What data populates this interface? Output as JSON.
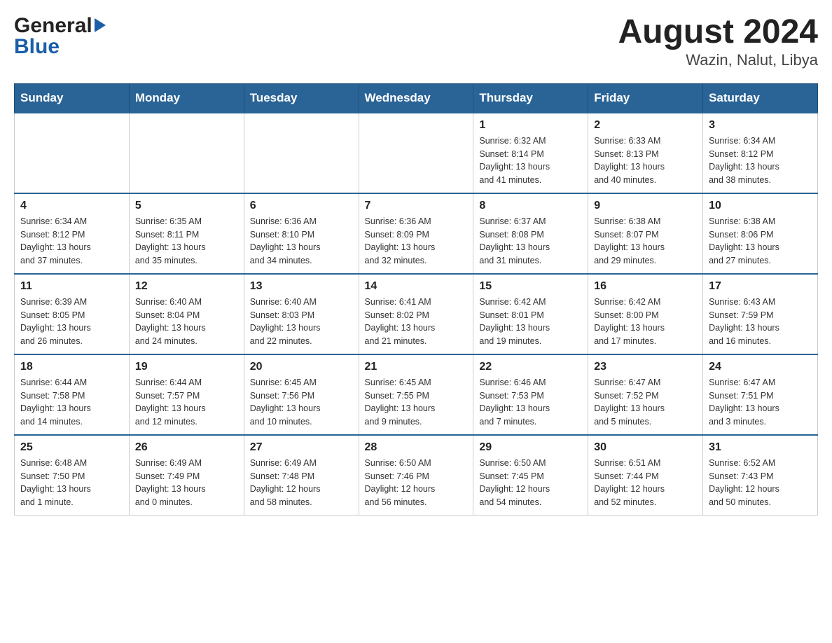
{
  "header": {
    "logo_general": "General",
    "logo_blue": "Blue",
    "month_year": "August 2024",
    "location": "Wazin, Nalut, Libya"
  },
  "calendar": {
    "days_of_week": [
      "Sunday",
      "Monday",
      "Tuesday",
      "Wednesday",
      "Thursday",
      "Friday",
      "Saturday"
    ],
    "weeks": [
      [
        {
          "day": "",
          "info": ""
        },
        {
          "day": "",
          "info": ""
        },
        {
          "day": "",
          "info": ""
        },
        {
          "day": "",
          "info": ""
        },
        {
          "day": "1",
          "info": "Sunrise: 6:32 AM\nSunset: 8:14 PM\nDaylight: 13 hours\nand 41 minutes."
        },
        {
          "day": "2",
          "info": "Sunrise: 6:33 AM\nSunset: 8:13 PM\nDaylight: 13 hours\nand 40 minutes."
        },
        {
          "day": "3",
          "info": "Sunrise: 6:34 AM\nSunset: 8:12 PM\nDaylight: 13 hours\nand 38 minutes."
        }
      ],
      [
        {
          "day": "4",
          "info": "Sunrise: 6:34 AM\nSunset: 8:12 PM\nDaylight: 13 hours\nand 37 minutes."
        },
        {
          "day": "5",
          "info": "Sunrise: 6:35 AM\nSunset: 8:11 PM\nDaylight: 13 hours\nand 35 minutes."
        },
        {
          "day": "6",
          "info": "Sunrise: 6:36 AM\nSunset: 8:10 PM\nDaylight: 13 hours\nand 34 minutes."
        },
        {
          "day": "7",
          "info": "Sunrise: 6:36 AM\nSunset: 8:09 PM\nDaylight: 13 hours\nand 32 minutes."
        },
        {
          "day": "8",
          "info": "Sunrise: 6:37 AM\nSunset: 8:08 PM\nDaylight: 13 hours\nand 31 minutes."
        },
        {
          "day": "9",
          "info": "Sunrise: 6:38 AM\nSunset: 8:07 PM\nDaylight: 13 hours\nand 29 minutes."
        },
        {
          "day": "10",
          "info": "Sunrise: 6:38 AM\nSunset: 8:06 PM\nDaylight: 13 hours\nand 27 minutes."
        }
      ],
      [
        {
          "day": "11",
          "info": "Sunrise: 6:39 AM\nSunset: 8:05 PM\nDaylight: 13 hours\nand 26 minutes."
        },
        {
          "day": "12",
          "info": "Sunrise: 6:40 AM\nSunset: 8:04 PM\nDaylight: 13 hours\nand 24 minutes."
        },
        {
          "day": "13",
          "info": "Sunrise: 6:40 AM\nSunset: 8:03 PM\nDaylight: 13 hours\nand 22 minutes."
        },
        {
          "day": "14",
          "info": "Sunrise: 6:41 AM\nSunset: 8:02 PM\nDaylight: 13 hours\nand 21 minutes."
        },
        {
          "day": "15",
          "info": "Sunrise: 6:42 AM\nSunset: 8:01 PM\nDaylight: 13 hours\nand 19 minutes."
        },
        {
          "day": "16",
          "info": "Sunrise: 6:42 AM\nSunset: 8:00 PM\nDaylight: 13 hours\nand 17 minutes."
        },
        {
          "day": "17",
          "info": "Sunrise: 6:43 AM\nSunset: 7:59 PM\nDaylight: 13 hours\nand 16 minutes."
        }
      ],
      [
        {
          "day": "18",
          "info": "Sunrise: 6:44 AM\nSunset: 7:58 PM\nDaylight: 13 hours\nand 14 minutes."
        },
        {
          "day": "19",
          "info": "Sunrise: 6:44 AM\nSunset: 7:57 PM\nDaylight: 13 hours\nand 12 minutes."
        },
        {
          "day": "20",
          "info": "Sunrise: 6:45 AM\nSunset: 7:56 PM\nDaylight: 13 hours\nand 10 minutes."
        },
        {
          "day": "21",
          "info": "Sunrise: 6:45 AM\nSunset: 7:55 PM\nDaylight: 13 hours\nand 9 minutes."
        },
        {
          "day": "22",
          "info": "Sunrise: 6:46 AM\nSunset: 7:53 PM\nDaylight: 13 hours\nand 7 minutes."
        },
        {
          "day": "23",
          "info": "Sunrise: 6:47 AM\nSunset: 7:52 PM\nDaylight: 13 hours\nand 5 minutes."
        },
        {
          "day": "24",
          "info": "Sunrise: 6:47 AM\nSunset: 7:51 PM\nDaylight: 13 hours\nand 3 minutes."
        }
      ],
      [
        {
          "day": "25",
          "info": "Sunrise: 6:48 AM\nSunset: 7:50 PM\nDaylight: 13 hours\nand 1 minute."
        },
        {
          "day": "26",
          "info": "Sunrise: 6:49 AM\nSunset: 7:49 PM\nDaylight: 13 hours\nand 0 minutes."
        },
        {
          "day": "27",
          "info": "Sunrise: 6:49 AM\nSunset: 7:48 PM\nDaylight: 12 hours\nand 58 minutes."
        },
        {
          "day": "28",
          "info": "Sunrise: 6:50 AM\nSunset: 7:46 PM\nDaylight: 12 hours\nand 56 minutes."
        },
        {
          "day": "29",
          "info": "Sunrise: 6:50 AM\nSunset: 7:45 PM\nDaylight: 12 hours\nand 54 minutes."
        },
        {
          "day": "30",
          "info": "Sunrise: 6:51 AM\nSunset: 7:44 PM\nDaylight: 12 hours\nand 52 minutes."
        },
        {
          "day": "31",
          "info": "Sunrise: 6:52 AM\nSunset: 7:43 PM\nDaylight: 12 hours\nand 50 minutes."
        }
      ]
    ]
  }
}
